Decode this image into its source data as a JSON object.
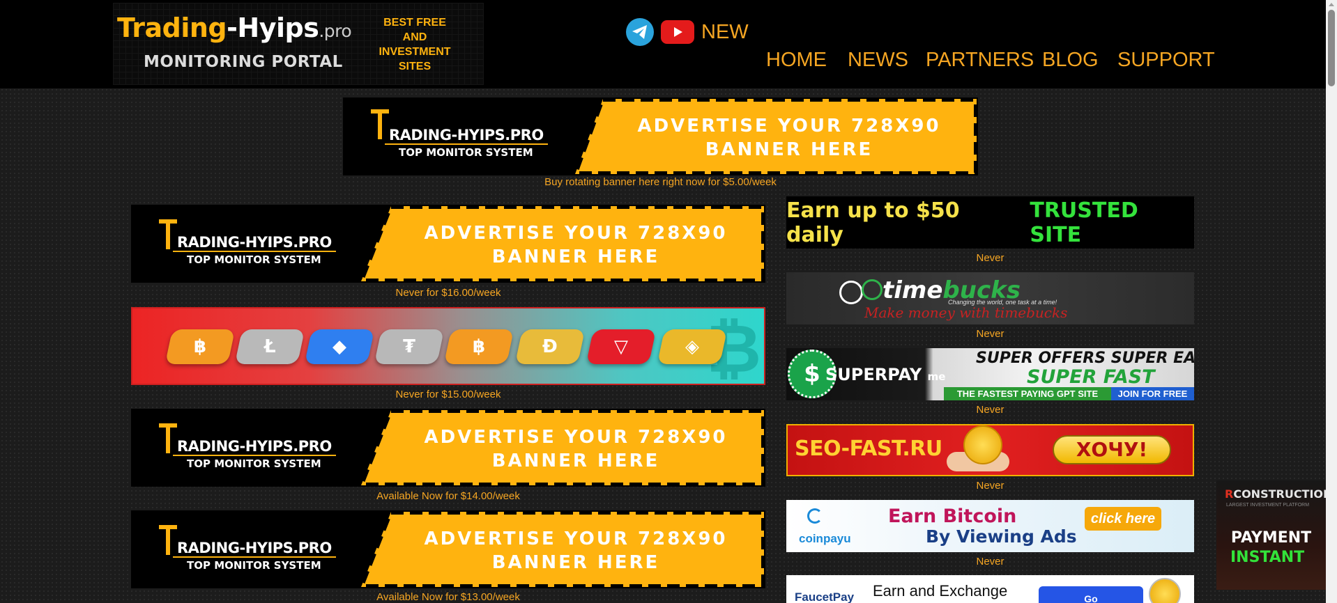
{
  "header": {
    "logo": {
      "name_part1": "Trading",
      "name_sep": "-",
      "name_part2": "Hyips",
      "name_suffix": ".pro",
      "subtitle": "MONITORING PORTAL",
      "tagline": [
        "BEST FREE",
        "AND",
        "INVESTMENT",
        "SITES"
      ]
    },
    "social": {
      "telegram_icon": "telegram-icon",
      "youtube_icon": "youtube-icon",
      "new_label": "NEW"
    },
    "nav": [
      {
        "label": "HOME"
      },
      {
        "label": "NEWS"
      },
      {
        "label": "PARTNERS"
      },
      {
        "label": "BLOG"
      },
      {
        "label": "SUPPORT"
      }
    ]
  },
  "ad_template": {
    "brand_t": "T",
    "brand_rest": "RADING-HYIPS.PRO",
    "subtitle": "TOP MONITOR SYSTEM",
    "text_line1": "ADVERTISE YOUR  728X90",
    "text_line2": "BANNER HERE"
  },
  "top_banner": {
    "caption": "Buy rotating banner here right now for $5.00/week"
  },
  "left_banners": [
    {
      "kind": "advertise",
      "caption": "Never for $16.00/week"
    },
    {
      "kind": "crypto",
      "caption": "Never for $15.00/week"
    },
    {
      "kind": "advertise",
      "caption": "Available Now for $14.00/week"
    },
    {
      "kind": "advertise",
      "caption": "Available Now for $13.00/week"
    }
  ],
  "crypto_banner": {
    "coins": [
      {
        "symbol": "฿",
        "color": "#f39a22"
      },
      {
        "symbol": "Ł",
        "color": "#b9b9b9"
      },
      {
        "symbol": "◆",
        "color": "#2f7ff0"
      },
      {
        "symbol": "₮",
        "color": "#b8b8b8"
      },
      {
        "symbol": "฿",
        "color": "#f39a22"
      },
      {
        "symbol": "Đ",
        "color": "#e8bb3a"
      },
      {
        "symbol": "▽",
        "color": "#e41e2a"
      },
      {
        "symbol": "◈",
        "color": "#eab82a"
      }
    ],
    "bg_symbol": "₿"
  },
  "right_ads": {
    "earn": {
      "text_a": "Earn up to $50 daily",
      "text_b": "TRUSTED SITE",
      "caption": "Never"
    },
    "timebucks": {
      "name_a": "time",
      "name_b": "bucks",
      "tagline": "Changing the world, one task at a time!",
      "script": "Make money with timebucks",
      "caption": "Never"
    },
    "superpay": {
      "icon_symbol": "$",
      "name": "SUPERPAY",
      "name_suffix": "me",
      "line1": "SUPER OFFERS  SUPER EARNING",
      "line2": "SUPER FAST",
      "bar1": "THE FASTEST PAYING GPT SITE",
      "bar2": "JOIN FOR FREE",
      "caption": "Never"
    },
    "seofast": {
      "name": "SEO-FAST.RU",
      "button": "ХОЧУ!",
      "caption": "Never"
    },
    "coinpayu": {
      "logo": "coinpayu",
      "line1": "Earn Bitcoin",
      "line2": "By Viewing Ads",
      "button": "click here",
      "caption": "Never"
    },
    "faucetpay": {
      "logo": "FaucetPay",
      "text": "Earn and Exchange",
      "button": "Go"
    }
  },
  "construction": {
    "logo_r": "R",
    "logo_word": "CONSTRUCTION",
    "tagline": "LARGEST INVESTMENT PLATFORM",
    "line1": "PAYMENT",
    "line2": "INSTANT"
  },
  "colors": {
    "accent": "#f6a623",
    "banner_yellow": "#ffb30f",
    "page_bg": "#1c1c1c"
  }
}
